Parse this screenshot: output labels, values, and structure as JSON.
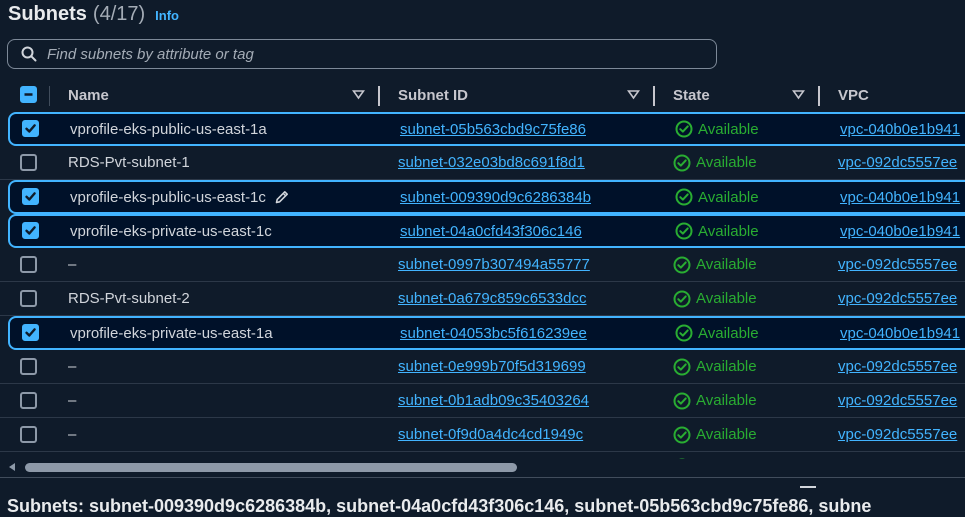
{
  "header": {
    "title": "Subnets",
    "count": "(4/17)",
    "info_label": "Info"
  },
  "search": {
    "placeholder": "Find subnets by attribute or tag"
  },
  "columns": {
    "name": "Name",
    "subnet_id": "Subnet ID",
    "state": "State",
    "vpc": "VPC"
  },
  "rows": [
    {
      "name": "vprofile-eks-public-us-east-1a",
      "subnet_id": "subnet-05b563cbd9c75fe86",
      "state": "Available",
      "vpc": "vpc-040b0e1b941",
      "selected": true
    },
    {
      "name": "RDS-Pvt-subnet-1",
      "subnet_id": "subnet-032e03bd8c691f8d1",
      "state": "Available",
      "vpc": "vpc-092dc5557ee",
      "selected": false
    },
    {
      "name": "vprofile-eks-public-us-east-1c",
      "subnet_id": "subnet-009390d9c6286384b",
      "state": "Available",
      "vpc": "vpc-040b0e1b941",
      "selected": true,
      "edit_icon": true
    },
    {
      "name": "vprofile-eks-private-us-east-1c",
      "subnet_id": "subnet-04a0cfd43f306c146",
      "state": "Available",
      "vpc": "vpc-040b0e1b941",
      "selected": true
    },
    {
      "name": "–",
      "subnet_id": "subnet-0997b307494a55777",
      "state": "Available",
      "vpc": "vpc-092dc5557ee",
      "selected": false
    },
    {
      "name": "RDS-Pvt-subnet-2",
      "subnet_id": "subnet-0a679c859c6533dcc",
      "state": "Available",
      "vpc": "vpc-092dc5557ee",
      "selected": false
    },
    {
      "name": "vprofile-eks-private-us-east-1a",
      "subnet_id": "subnet-04053bc5f616239ee",
      "state": "Available",
      "vpc": "vpc-040b0e1b941",
      "selected": true
    },
    {
      "name": "–",
      "subnet_id": "subnet-0e999b70f5d319699",
      "state": "Available",
      "vpc": "vpc-092dc5557ee",
      "selected": false
    },
    {
      "name": "–",
      "subnet_id": "subnet-0b1adb09c35403264",
      "state": "Available",
      "vpc": "vpc-092dc5557ee",
      "selected": false
    },
    {
      "name": "–",
      "subnet_id": "subnet-0f9d0a4dc4cd1949c",
      "state": "Available",
      "vpc": "vpc-092dc5557ee",
      "selected": false
    }
  ],
  "bottom_panel": {
    "title": "Subnets: subnet-009390d9c6286384b, subnet-04a0cfd43f306c146, subnet-05b563cbd9c75fe86, subne"
  },
  "colors": {
    "accent": "#42b4ff",
    "available": "#29ad32",
    "background": "#0f1b2a",
    "selected_row": "#001129"
  }
}
